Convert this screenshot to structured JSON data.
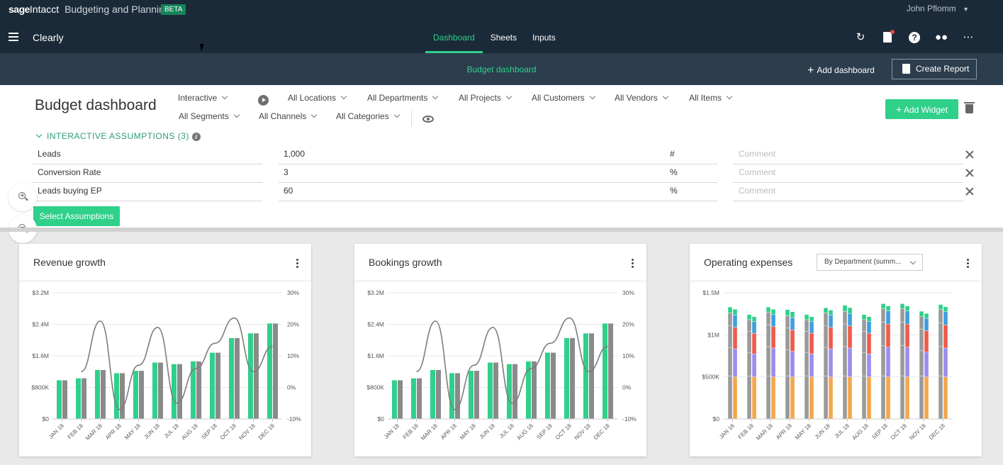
{
  "brand": {
    "sage": "sage",
    "intacct": "Intacct",
    "product": "Budgeting and Planning",
    "badge": "BETA"
  },
  "user": {
    "name": "John Pflomm"
  },
  "app": {
    "name": "Clearly"
  },
  "nav": {
    "tabs": [
      "Dashboard",
      "Sheets",
      "Inputs"
    ],
    "active": "Dashboard"
  },
  "toolbar_icons": [
    "refresh-icon",
    "clipboard-icon",
    "help-icon",
    "people-icon",
    "more-icon"
  ],
  "subbar": {
    "title": "Budget dashboard",
    "add_dashboard": "Add dashboard",
    "create_report": "Create Report"
  },
  "dashboard": {
    "title": "Budget dashboard",
    "mode": "Interactive",
    "filters_row1": [
      "All Locations",
      "All Departments",
      "All Projects",
      "All Customers",
      "All Vendors",
      "All Items"
    ],
    "filters_row2": [
      "All Segments",
      "All Channels",
      "All Categories"
    ],
    "add_widget": "Add Widget"
  },
  "assumptions": {
    "header": "INTERACTIVE ASSUMPTIONS (3)",
    "rows": [
      {
        "name": "Leads",
        "value": "1,000",
        "unit": "#",
        "comment": "Comment"
      },
      {
        "name": "Conversion Rate",
        "value": "3",
        "unit": "%",
        "comment": "Comment"
      },
      {
        "name": "Leads buying EP",
        "value": "60",
        "unit": "%",
        "comment": "Comment"
      }
    ],
    "select_button": "Select Assumptions"
  },
  "widgets": {
    "revenue": {
      "title": "Revenue growth"
    },
    "bookings": {
      "title": "Bookings growth"
    },
    "opex": {
      "title": "Operating expenses",
      "dropdown": "By Department (summ..."
    }
  },
  "chart_data": [
    {
      "type": "bar",
      "title": "Revenue growth",
      "categories": [
        "JAN 18",
        "FEB 18",
        "MAR 18",
        "APR 18",
        "MAY 18",
        "JUN 18",
        "JUL 18",
        "AUG 18",
        "SEP 18",
        "OCT 18",
        "NOV 18",
        "DEC 18"
      ],
      "y_ticks": [
        "$0",
        "$800K",
        "$1.6M",
        "$2.4M",
        "$3.2M"
      ],
      "y2_ticks": [
        "-10%",
        "0%",
        "10%",
        "20%",
        "30%"
      ],
      "ylim": [
        0,
        3200000
      ],
      "y2lim": [
        -10,
        30
      ],
      "series": [
        {
          "values": [
            980000,
            1030000,
            1240000,
            1160000,
            1220000,
            1430000,
            1390000,
            1460000,
            1680000,
            2050000,
            2170000,
            2420000
          ],
          "color": "#2fd08a"
        },
        {
          "values": [
            980000,
            1030000,
            1240000,
            1160000,
            1220000,
            1430000,
            1390000,
            1460000,
            1680000,
            2050000,
            2170000,
            2420000
          ],
          "color": "#8a8a8a"
        },
        {
          "type": "line",
          "values": [
            null,
            5,
            21,
            -7,
            7,
            19,
            -5,
            6,
            14,
            22,
            5,
            13
          ],
          "color": "#7d7d7d"
        }
      ]
    },
    {
      "type": "bar",
      "title": "Bookings growth",
      "categories": [
        "JAN 18",
        "FEB 18",
        "MAR 18",
        "APR 18",
        "MAY 18",
        "JUN 18",
        "JUL 18",
        "AUG 18",
        "SEP 18",
        "OCT 18",
        "NOV 18",
        "DEC 18"
      ],
      "y_ticks": [
        "$0",
        "$800K",
        "$1.6M",
        "$2.4M",
        "$3.2M"
      ],
      "y2_ticks": [
        "-10%",
        "0%",
        "10%",
        "20%",
        "30%"
      ],
      "ylim": [
        0,
        3200000
      ],
      "y2lim": [
        -10,
        30
      ],
      "series": [
        {
          "values": [
            980000,
            1030000,
            1240000,
            1160000,
            1220000,
            1430000,
            1390000,
            1460000,
            1680000,
            2050000,
            2170000,
            2420000
          ],
          "color": "#2fd08a"
        },
        {
          "values": [
            980000,
            1030000,
            1240000,
            1160000,
            1220000,
            1430000,
            1390000,
            1460000,
            1680000,
            2050000,
            2170000,
            2420000
          ],
          "color": "#8a8a8a"
        },
        {
          "type": "line",
          "values": [
            null,
            5,
            21,
            -7,
            7,
            19,
            -5,
            6,
            14,
            22,
            5,
            13
          ],
          "color": "#7d7d7d"
        }
      ]
    },
    {
      "type": "bar",
      "title": "Operating expenses",
      "stacked": true,
      "categories": [
        "JAN 18",
        "FEB 18",
        "MAR 18",
        "APR 18",
        "MAY 18",
        "JUN 18",
        "JUL 18",
        "AUG 18",
        "SEP 18",
        "OCT 18",
        "NOV 18",
        "DEC 18"
      ],
      "y_ticks": [
        "$0",
        "$500K",
        "$1M",
        "$1.5M"
      ],
      "ylim": [
        0,
        1500000
      ],
      "series": [
        {
          "values": [
            510000,
            510000,
            510000,
            510000,
            510000,
            510000,
            510000,
            510000,
            510000,
            510000,
            510000,
            510000
          ],
          "color": "#f5a64a"
        },
        {
          "values": [
            340000,
            280000,
            350000,
            310000,
            280000,
            340000,
            350000,
            280000,
            360000,
            360000,
            300000,
            350000
          ],
          "color": "#9b8cf0"
        },
        {
          "values": [
            260000,
            250000,
            260000,
            260000,
            250000,
            260000,
            270000,
            250000,
            280000,
            280000,
            260000,
            280000
          ],
          "color": "#f05a4a"
        },
        {
          "values": [
            150000,
            140000,
            150000,
            150000,
            140000,
            150000,
            150000,
            140000,
            160000,
            160000,
            150000,
            160000
          ],
          "color": "#3d9fe0"
        },
        {
          "values": [
            70000,
            60000,
            60000,
            70000,
            60000,
            60000,
            70000,
            60000,
            60000,
            60000,
            60000,
            60000
          ],
          "color": "#2fd08a"
        }
      ]
    }
  ]
}
